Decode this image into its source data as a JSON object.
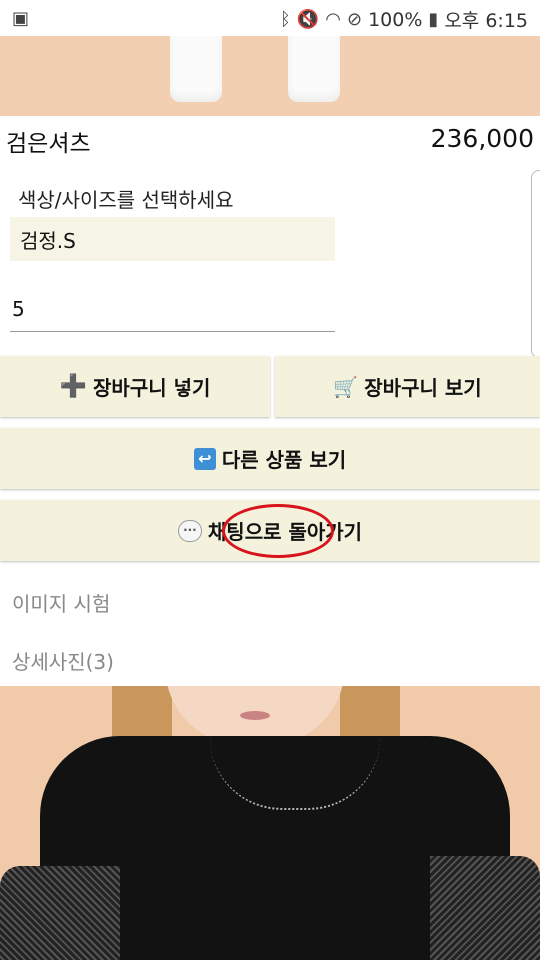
{
  "status_bar": {
    "battery": "100%",
    "time": "오후 6:15",
    "icons": [
      "image-icon",
      "bluetooth-icon",
      "mute-icon",
      "wifi-icon",
      "no-sign-icon",
      "battery-icon"
    ]
  },
  "product": {
    "name": "검은셔츠",
    "price": "236,000"
  },
  "options": {
    "label": "색상/사이즈를 선택하세요",
    "selected": "검정.S",
    "quantity": "5"
  },
  "buttons": {
    "add_cart": "장바구니 넣기",
    "view_cart": "장바구니 보기",
    "other_products": "다른 상품 보기",
    "back_to_chat": "채팅으로 돌아가기"
  },
  "sections": {
    "image_test": "이미지 시험",
    "detail_photos": "상세사진(3)"
  },
  "colors": {
    "button_bg": "#f4f2dc",
    "option_bg": "#f6f5e5",
    "annotation_red": "#d8141c"
  }
}
